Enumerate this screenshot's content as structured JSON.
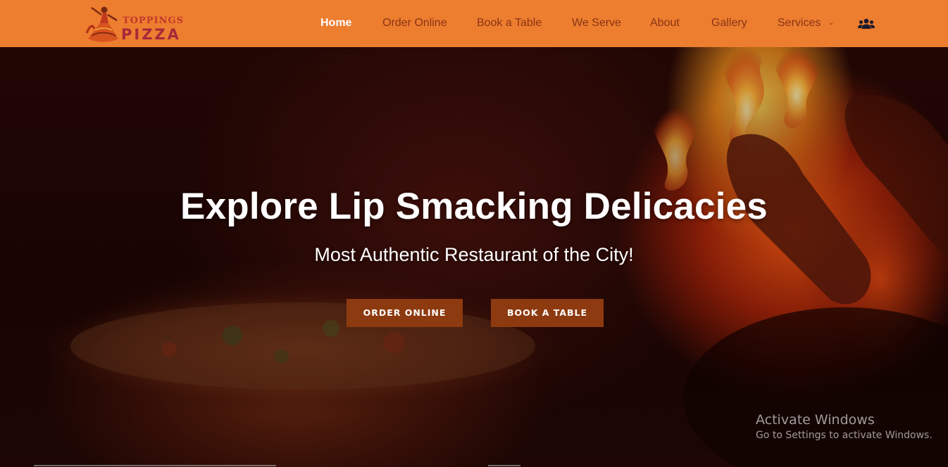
{
  "header": {
    "logo": {
      "line1": "TOPPINGS",
      "line2": "PIZZA"
    },
    "nav": [
      {
        "label": "Home",
        "active": true
      },
      {
        "label": "Order Online"
      },
      {
        "label": "Book a Table"
      },
      {
        "label": "We Serve"
      },
      {
        "label": "About"
      },
      {
        "label": "Gallery"
      },
      {
        "label": "Services",
        "has_dropdown": true
      }
    ],
    "account_icon": "users-icon",
    "background_color": "#ed7d2f",
    "nav_text_color": "#8a3415",
    "active_text_color": "#ffffff"
  },
  "hero": {
    "title": "Explore Lip Smacking Delicacies",
    "subtitle": "Most Authentic Restaurant of the City!",
    "buttons": {
      "order": "ORDER ONLINE",
      "book": "BOOK A TABLE"
    },
    "button_color": "#8e3a10"
  },
  "watermark": {
    "title": "Activate Windows",
    "subtitle": "Go to Settings to activate Windows."
  }
}
